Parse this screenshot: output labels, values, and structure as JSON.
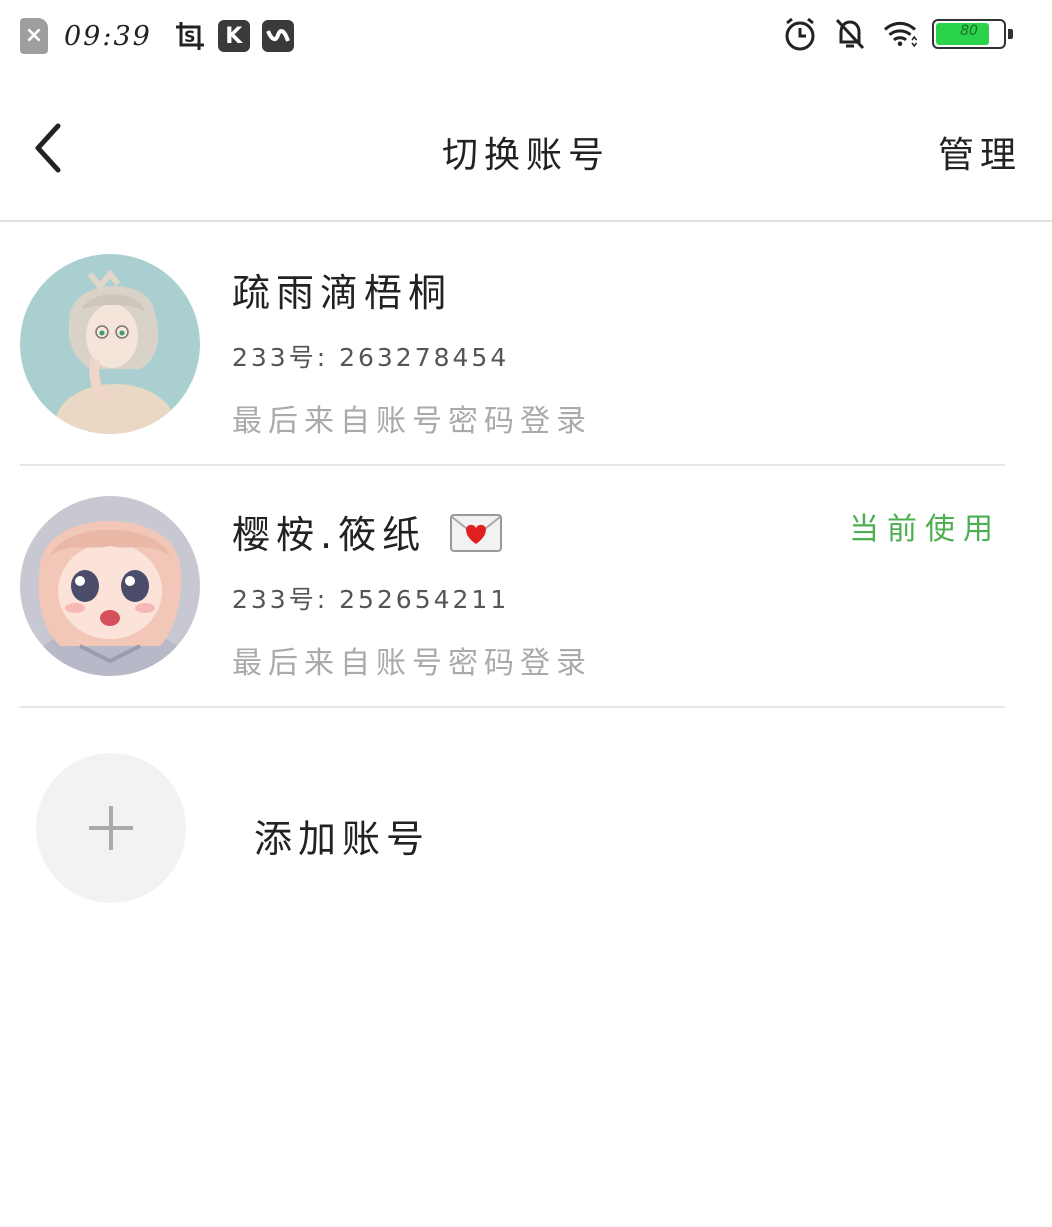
{
  "status_bar": {
    "time": "09:39",
    "battery_level": "80",
    "battery_fraction": 0.8,
    "battery_color": "#2bd34a",
    "left_icons": [
      "sim-missing-icon",
      "screenshot-crop-icon",
      "k-app-icon",
      "w-app-icon"
    ],
    "right_icons": [
      "alarm-icon",
      "notifications-off-icon",
      "wifi-icon",
      "battery-icon"
    ]
  },
  "header": {
    "title": "切换账号",
    "manage_label": "管理"
  },
  "accounts": [
    {
      "name": "疏雨滴梧桐",
      "id_line": "233号: 263278454",
      "login_method": "最后来自账号密码登录",
      "current": false
    },
    {
      "name": "樱桉.筱纸",
      "name_emoji": "love-letter-icon",
      "id_line": "233号: 252654211",
      "login_method": "最后来自账号密码登录",
      "current": true,
      "current_label": "当前使用"
    }
  ],
  "add_account": {
    "label": "添加账号"
  },
  "colors": {
    "accent_green": "#4caf50",
    "secondary_text": "#aaaaaa",
    "divider": "#e6e6e6"
  }
}
